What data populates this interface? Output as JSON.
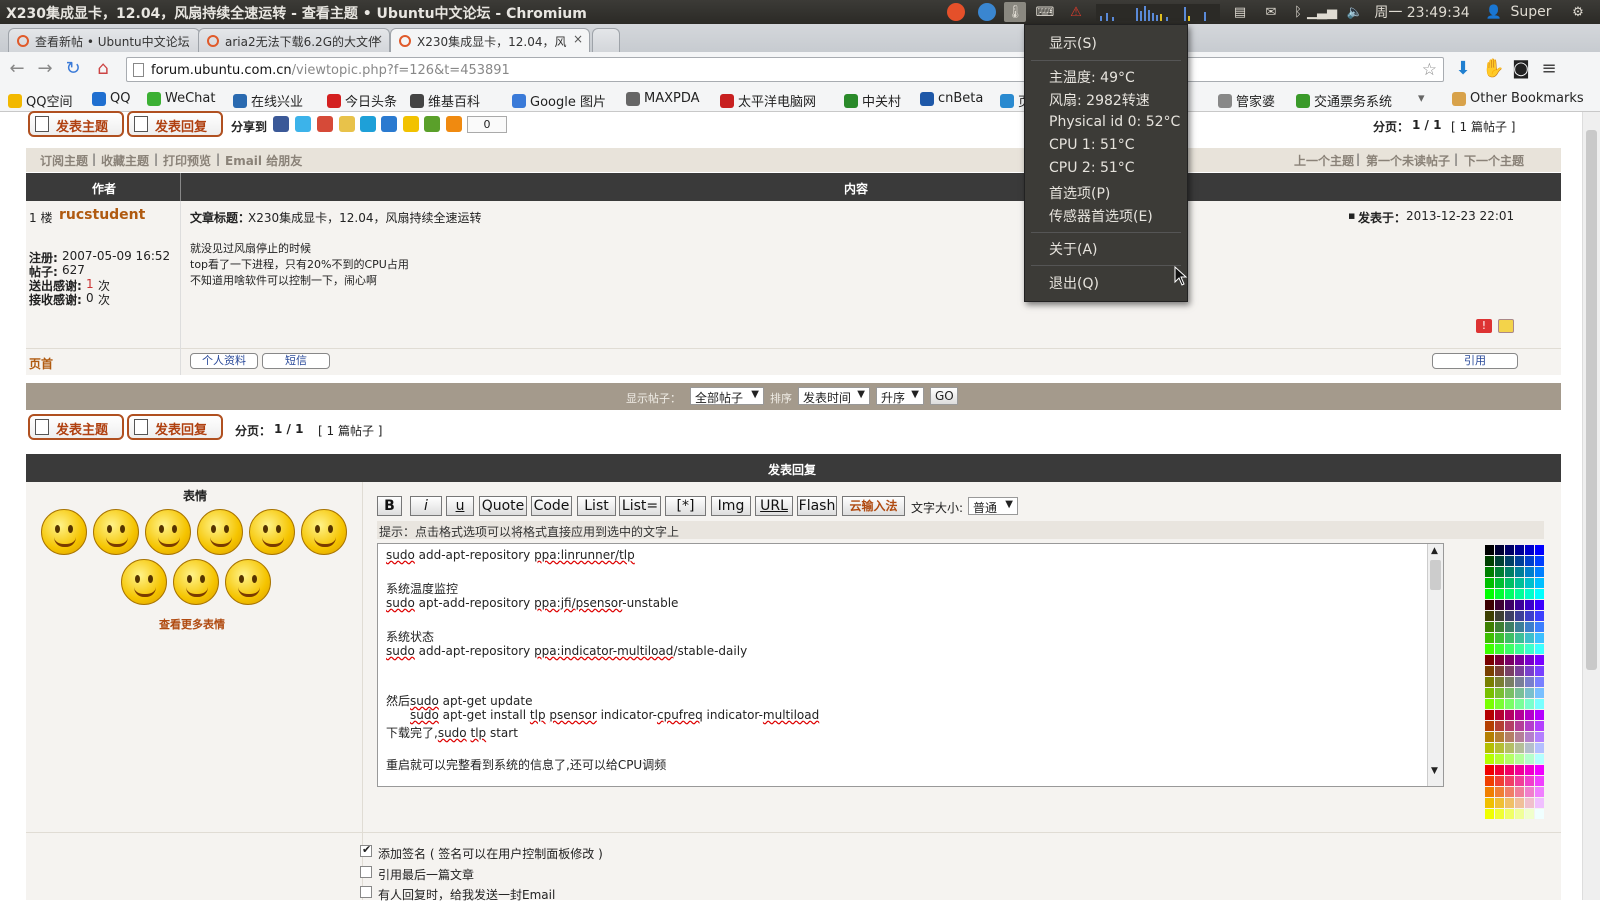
{
  "topbar": {
    "window_title": "X230集成显卡，12.04，风扇持续全速运转 - 查看主题 • Ubuntu中文论坛 - Chromium",
    "clock": "周一 23:49:34",
    "user": "Super"
  },
  "tabs": [
    {
      "label": "查看新帖 • Ubuntu中文论坛"
    },
    {
      "label": "aria2无法下载6.2G的大文件"
    },
    {
      "label": "X230集成显卡，12.04，风"
    }
  ],
  "address": {
    "host": "forum.ubuntu.com.cn",
    "path": "/viewtopic.php?f=126&t=453891"
  },
  "bookmarks": [
    {
      "label": "QQ空间",
      "color": "#f2b800"
    },
    {
      "label": "QQ",
      "color": "#1f6fd0"
    },
    {
      "label": "WeChat",
      "color": "#3cb034"
    },
    {
      "label": "在线兴业",
      "color": "#2a6ab0"
    },
    {
      "label": "今日头条",
      "color": "#d42020"
    },
    {
      "label": "维基百科",
      "color": "#444444"
    },
    {
      "label": "Google 图片",
      "color": "#3a7ad8"
    },
    {
      "label": "MAXPDA",
      "color": "#666666"
    },
    {
      "label": "太平洋电脑网",
      "color": "#c82020"
    },
    {
      "label": "中关村",
      "color": "#2a8a2a"
    },
    {
      "label": "cnBeta",
      "color": "#1e58a8"
    },
    {
      "label": "页",
      "color": "#2a8ad0"
    },
    {
      "label": "管家婆",
      "color": "#888888"
    },
    {
      "label": "交通票务系统",
      "color": "#3a9a2a"
    }
  ],
  "other_bookmarks": "Other Bookmarks",
  "sensor_menu": {
    "items": [
      "显示(S)",
      "主温度: 49°C",
      "风扇: 2982转速",
      "Physical id 0: 52°C",
      "CPU 1: 51°C",
      "CPU 2: 51°C",
      "首选项(P)",
      "传感器首选项(E)",
      "关于(A)",
      "退出(Q)"
    ]
  },
  "forum": {
    "new_topic": "发表主题",
    "reply": "发表回复",
    "share_to": "分享到",
    "share_count": "0",
    "pagination_top": "分页：",
    "pages": "1 / 1",
    "post_count": "[ 1 篇帖子 ]",
    "subscribe": "订阅主题",
    "bookmark": "收藏主题",
    "print": "打印预览",
    "email": "Email 给朋友",
    "prev_topic": "上一个主题",
    "first_unread": "第一个未读帖子",
    "next_topic": "下一个主题",
    "col_author": "作者",
    "col_content": "内容",
    "post": {
      "floor": "1 楼",
      "author": "rucstudent",
      "subject_label": "文章标题：",
      "subject": "X230集成显卡，12.04，风扇持续全速运转",
      "posted_label": "发表于：",
      "posted": "2013-12-23 22:01",
      "reg_label": "注册:",
      "reg": "2007-05-09 16:52",
      "posts_label": "帖子:",
      "posts": "627",
      "thanks_sent_label": "送出感谢:",
      "thanks_sent": "1",
      "thanks_recv_label": "接收感谢:",
      "thanks_recv": "0",
      "times": "次",
      "body": [
        "就没见过风扇停止的时候",
        "top看了一下进程，只有20%不到的CPU占用",
        "不知道用啥软件可以控制一下，闹心啊"
      ],
      "top": "页首",
      "profile": "个人资料",
      "pm": "短信",
      "quote": "引用"
    },
    "display_posts": "显示帖子：",
    "display_value": "全部帖子",
    "sort": "排序",
    "sort_value": "发表时间",
    "order_value": "升序",
    "go": "GO",
    "reply_header": "发表回复",
    "smilies": "表情",
    "more_smilies": "查看更多表情",
    "format_buttons": [
      "B",
      "i",
      "u",
      "Quote",
      "Code",
      "List",
      "List=",
      "[*]",
      "Img",
      "URL",
      "Flash",
      "云输入法"
    ],
    "font_size_label": "文字大小:",
    "font_size_value": "普通",
    "hint": "提示：点击格式选项可以将格式直接应用到选中的文字上",
    "editor_lines": [
      "sudo add-apt-repository ppa:linrunner/tlp",
      "",
      "系统温度监控",
      "sudo apt-add-repository ppa:jfi/psensor-unstable",
      "",
      "系统状态",
      "sudo add-apt-repository ppa:indicator-multiload/stable-daily",
      "",
      "",
      "然后sudo apt-get update",
      "      sudo apt-get install tlp psensor indicator-cpufreq indicator-multiload",
      "下载完了,sudo tlp start",
      "",
      "重启就可以完整看到系统的信息了,还可以给CPU调频"
    ],
    "opt_signature": "添加签名 ( 签名可以在用户控制面板修改 )",
    "opt_quote_last": "引用最后一篇文章",
    "opt_notify": "有人回复时，给我发送一封Email"
  }
}
